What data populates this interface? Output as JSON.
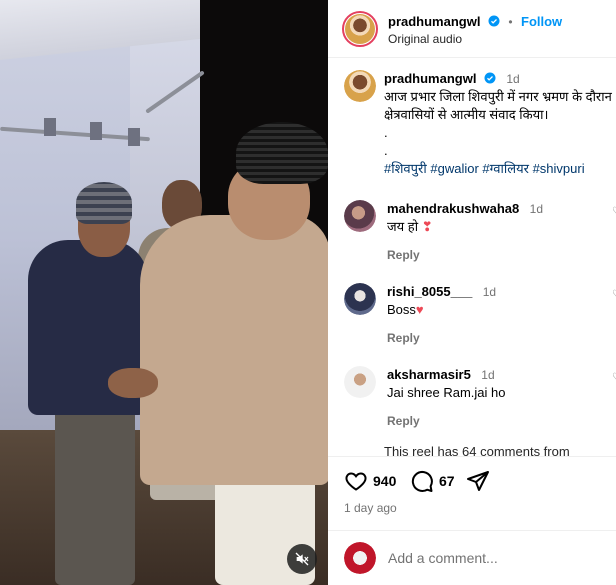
{
  "video": {
    "mute_icon": "speaker-muted-icon"
  },
  "header": {
    "username": "pradhumangwl",
    "follow_label": "Follow",
    "separator": "•",
    "audio_label": "Original audio"
  },
  "caption": {
    "username": "pradhumangwl",
    "time": "1d",
    "text": "आज प्रभार जिला शिवपुरी में नगर भ्रमण के दौरान क्षेत्रवासियों से आत्मीय संवाद किया।",
    "dot1": ".",
    "dot2": ".",
    "hashtags": [
      "#शिवपुरी",
      "#gwalior",
      "#ग्वालियर",
      "#shivpuri"
    ]
  },
  "comments": [
    {
      "username": "mahendrakushwaha8",
      "time": "1d",
      "text": "जय हो ",
      "emoji": "❣",
      "reply": "Reply"
    },
    {
      "username": "rishi_8055___",
      "time": "1d",
      "text": "Boss",
      "emoji": "♥",
      "reply": "Reply"
    },
    {
      "username": "aksharmasir5",
      "time": "1d",
      "text": "Jai shree Ram.jai ho",
      "emoji": "",
      "reply": "Reply"
    }
  ],
  "truncated_text": "This reel has 64 comments from",
  "actions": {
    "likes": "940",
    "comments": "67",
    "time_ago": "1 day ago"
  },
  "add_comment": {
    "placeholder": "Add a comment..."
  },
  "colors": {
    "accent_blue": "#0095f6",
    "hashtag": "#00376b",
    "muted_text": "#737373",
    "heart_red": "#ed4956"
  }
}
